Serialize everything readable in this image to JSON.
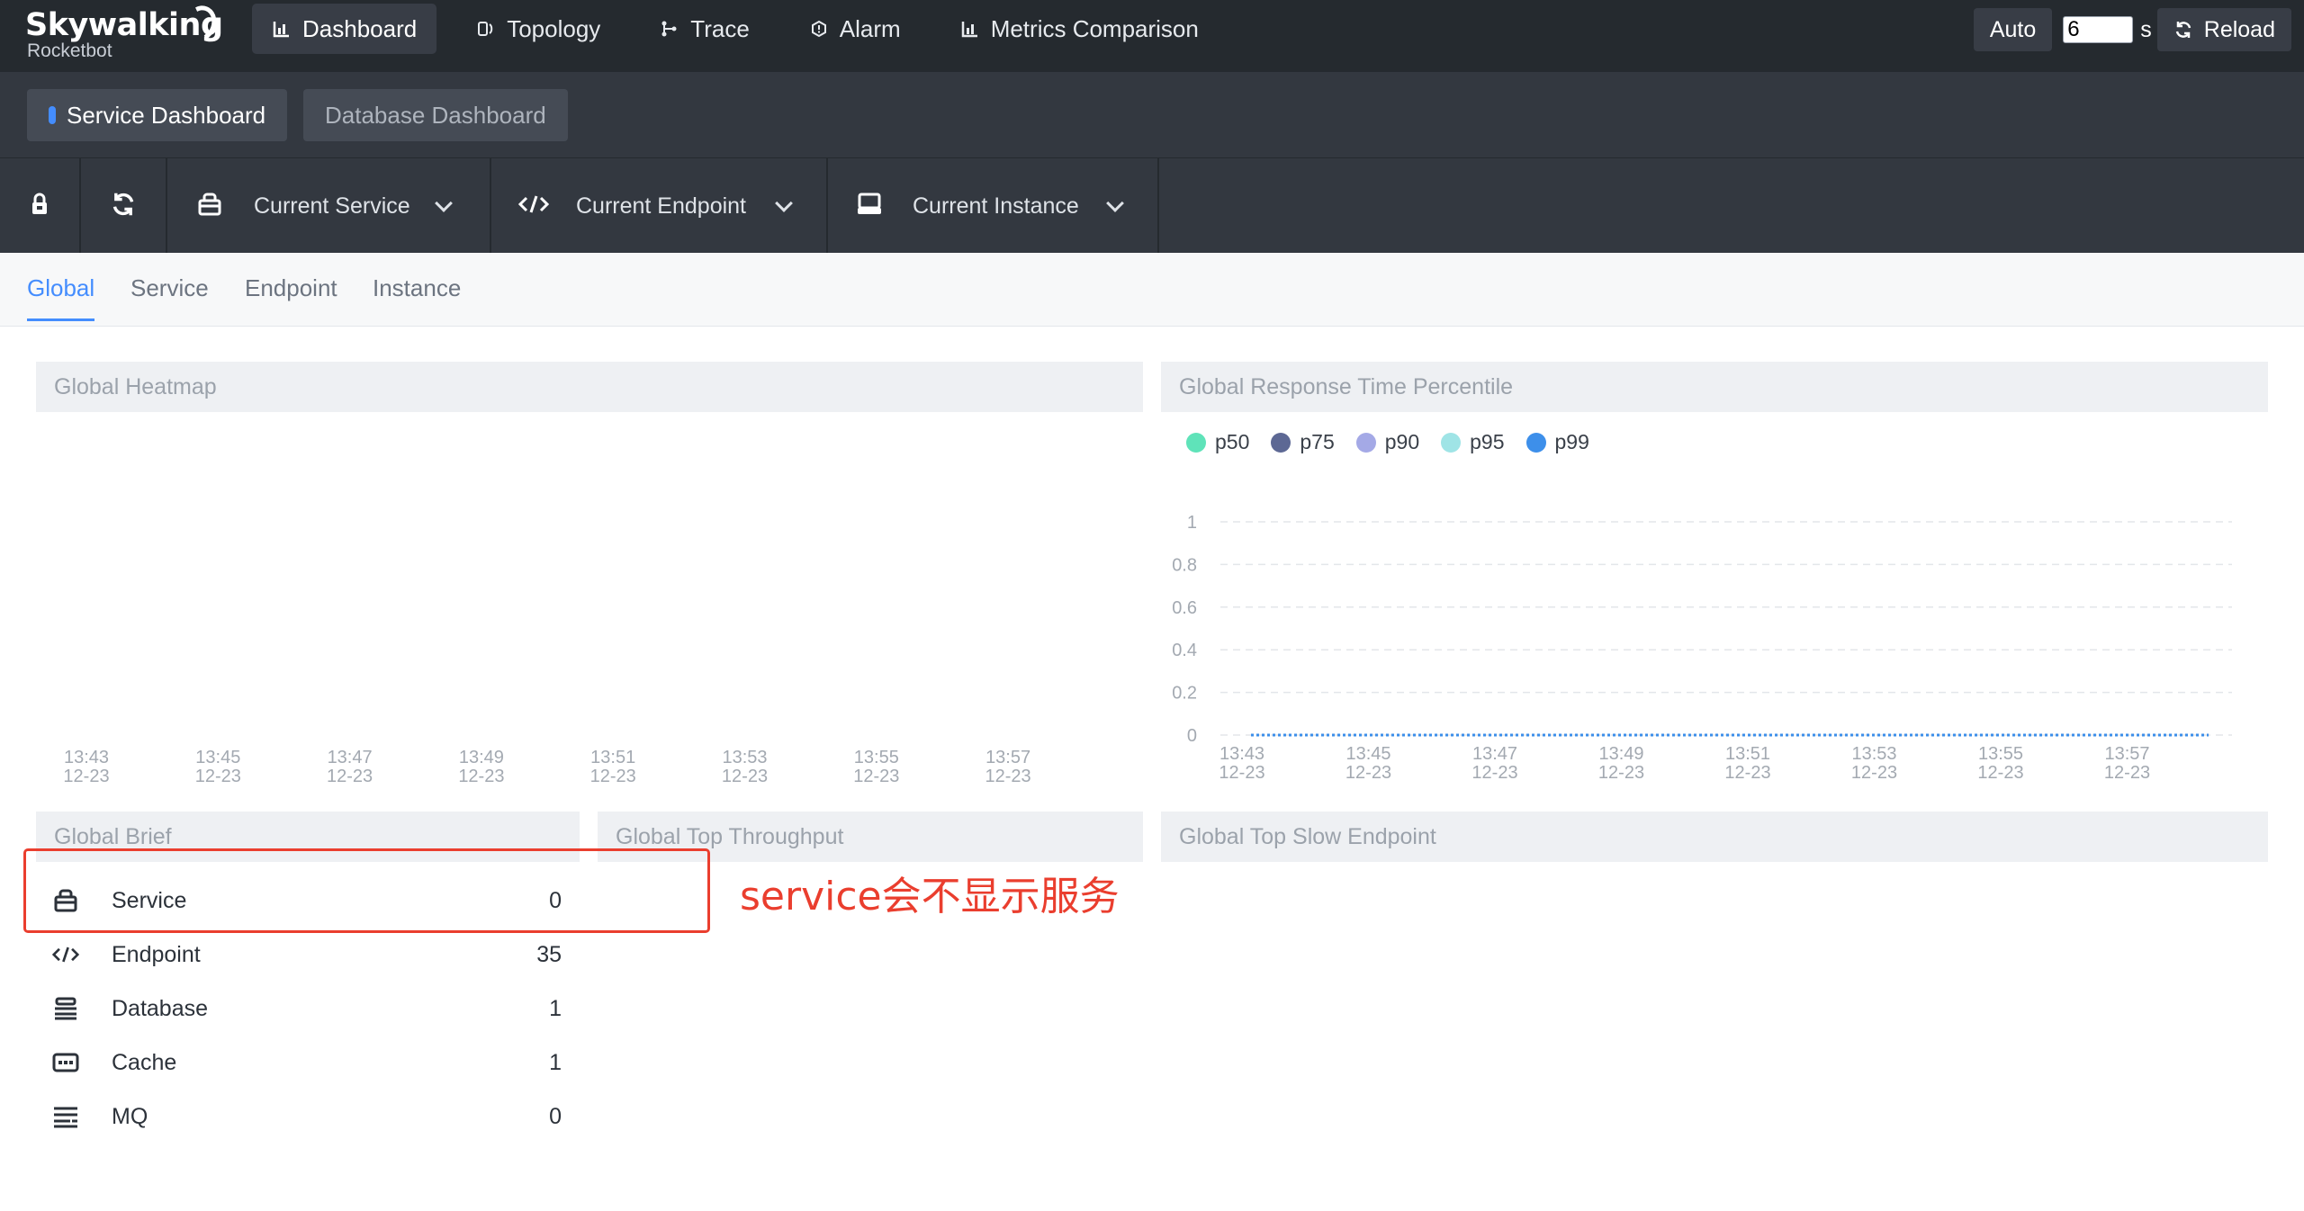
{
  "brand": {
    "name": "Skywalking",
    "sub": "Rocketbot"
  },
  "nav": [
    {
      "label": "Dashboard",
      "icon": "bar-chart-icon",
      "active": true
    },
    {
      "label": "Topology",
      "icon": "topology-icon",
      "active": false
    },
    {
      "label": "Trace",
      "icon": "trace-icon",
      "active": false
    },
    {
      "label": "Alarm",
      "icon": "alarm-icon",
      "active": false
    },
    {
      "label": "Metrics Comparison",
      "icon": "bar-chart-icon",
      "active": false
    }
  ],
  "top_right": {
    "auto_label": "Auto",
    "interval_value": "6",
    "interval_unit": "s",
    "reload_label": "Reload"
  },
  "dashboards": {
    "active": "Service Dashboard",
    "other": "Database Dashboard"
  },
  "selectors": {
    "service": "Current Service",
    "endpoint": "Current Endpoint",
    "instance": "Current Instance"
  },
  "subtabs": {
    "global": "Global",
    "service": "Service",
    "endpoint": "Endpoint",
    "instance": "Instance"
  },
  "panels": {
    "heatmap": "Global Heatmap",
    "percentile": "Global Response Time Percentile",
    "brief": "Global Brief",
    "throughput": "Global Top Throughput",
    "slow": "Global Top Slow Endpoint"
  },
  "time_ticks": [
    {
      "time": "13:43",
      "date": "12-23"
    },
    {
      "time": "13:45",
      "date": "12-23"
    },
    {
      "time": "13:47",
      "date": "12-23"
    },
    {
      "time": "13:49",
      "date": "12-23"
    },
    {
      "time": "13:51",
      "date": "12-23"
    },
    {
      "time": "13:53",
      "date": "12-23"
    },
    {
      "time": "13:55",
      "date": "12-23"
    },
    {
      "time": "13:57",
      "date": "12-23"
    }
  ],
  "chart_data": {
    "type": "line",
    "title": "Global Response Time Percentile",
    "x": [
      "13:43 12-23",
      "13:45 12-23",
      "13:47 12-23",
      "13:49 12-23",
      "13:51 12-23",
      "13:53 12-23",
      "13:55 12-23",
      "13:57 12-23"
    ],
    "ylim": [
      0,
      1
    ],
    "yticks": [
      "1",
      "0.8",
      "0.6",
      "0.4",
      "0.2",
      "0"
    ],
    "series": [
      {
        "name": "p50",
        "color": "#5fe3b9",
        "values": [
          0,
          0,
          0,
          0,
          0,
          0,
          0,
          0
        ]
      },
      {
        "name": "p75",
        "color": "#5d6894",
        "values": [
          0,
          0,
          0,
          0,
          0,
          0,
          0,
          0
        ]
      },
      {
        "name": "p90",
        "color": "#a4a9e6",
        "values": [
          0,
          0,
          0,
          0,
          0,
          0,
          0,
          0
        ]
      },
      {
        "name": "p95",
        "color": "#9fe4e6",
        "values": [
          0,
          0,
          0,
          0,
          0,
          0,
          0,
          0
        ]
      },
      {
        "name": "p99",
        "color": "#3d8fea",
        "values": [
          0,
          0,
          0,
          0,
          0,
          0,
          0,
          0
        ]
      }
    ],
    "legend": "top-left",
    "grid": true
  },
  "brief": [
    {
      "label": "Service",
      "value": "0",
      "icon": "service-icon"
    },
    {
      "label": "Endpoint",
      "value": "35",
      "icon": "code-icon"
    },
    {
      "label": "Database",
      "value": "1",
      "icon": "database-icon"
    },
    {
      "label": "Cache",
      "value": "1",
      "icon": "cache-icon"
    },
    {
      "label": "MQ",
      "value": "0",
      "icon": "mq-icon"
    }
  ],
  "annotation": "service会不显示服务"
}
